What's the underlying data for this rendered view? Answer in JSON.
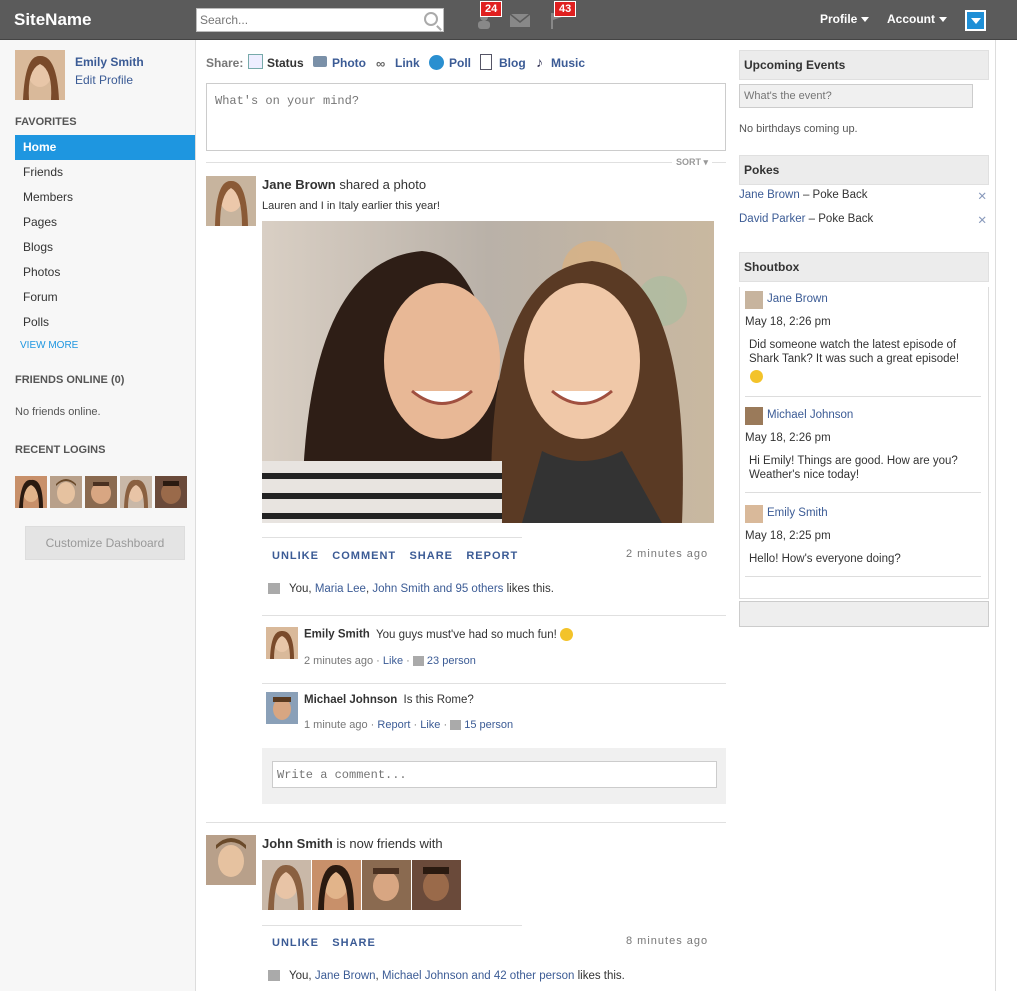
{
  "header": {
    "site_name": "SiteName",
    "search_placeholder": "Search...",
    "friend_requests_count": "24",
    "notifications_count": "43",
    "profile_label": "Profile",
    "account_label": "Account"
  },
  "sidebar": {
    "user_name": "Emily Smith",
    "edit_profile": "Edit Profile",
    "favorites_title": "FAVORITES",
    "items": [
      "Home",
      "Friends",
      "Members",
      "Pages",
      "Blogs",
      "Photos",
      "Forum",
      "Polls"
    ],
    "view_more": "VIEW MORE",
    "friends_online_title": "FRIENDS ONLINE (0)",
    "no_friends_online": "No friends online.",
    "recent_logins_title": "RECENT LOGINS",
    "customize_label": "Customize Dashboard"
  },
  "composer": {
    "share_label": "Share:",
    "tabs": [
      "Status",
      "Photo",
      "Link",
      "Poll",
      "Blog",
      "Music"
    ],
    "placeholder": "What's on your mind?",
    "sort_label": "SORT"
  },
  "post1": {
    "author": "Jane Brown",
    "action": "shared a photo",
    "caption": "Lauren and I in Italy earlier this year!",
    "actions": [
      "UNLIKE",
      "COMMENT",
      "SHARE",
      "REPORT"
    ],
    "time": "2 minutes ago",
    "likes_you": "You,",
    "likes_name1": "Maria Lee",
    "likes_name2": "John Smith and 95 others",
    "likes_suffix": "likes this.",
    "comments": [
      {
        "author": "Emily Smith",
        "text": "You guys must've had so much fun!",
        "time": "2 minutes ago",
        "like": "Like",
        "count": "23 person"
      },
      {
        "author": "Michael Johnson",
        "text": "Is this Rome?",
        "time": "1 minute ago",
        "report": "Report",
        "like": "Like",
        "count": "15 person"
      }
    ],
    "comment_placeholder": "Write a comment..."
  },
  "post2": {
    "author": "John Smith",
    "action": "is now friends with",
    "actions": [
      "UNLIKE",
      "SHARE"
    ],
    "time": "8 minutes ago",
    "likes_you": "You,",
    "likes_name1": "Jane Brown",
    "likes_name2": "Michael Johnson and 42 other person",
    "likes_suffix": "likes this."
  },
  "right": {
    "events_title": "Upcoming Events",
    "event_placeholder": "What's the event?",
    "no_birthdays": "No birthdays coming up.",
    "pokes_title": "Pokes",
    "pokes": [
      {
        "name": "Jane Brown",
        "action": "– Poke Back"
      },
      {
        "name": "David Parker",
        "action": "– Poke Back"
      }
    ],
    "shoutbox_title": "Shoutbox",
    "shouts": [
      {
        "name": "Jane Brown",
        "time": "May 18, 2:26 pm",
        "text": "Did someone watch the latest episode of Shark Tank? It was such a great episode!"
      },
      {
        "name": "Michael Johnson",
        "time": "May 18, 2:26 pm",
        "text": "Hi Emily! Things are good. How are you? Weather's nice today!"
      },
      {
        "name": "Emily Smith",
        "time": "May 18, 2:25 pm",
        "text": "Hello! How's everyone doing?"
      }
    ]
  },
  "colors": {
    "accent": "#1e96e0",
    "topbar": "#5b5b5b",
    "badge": "#e02020",
    "link": "#3b5b95"
  }
}
